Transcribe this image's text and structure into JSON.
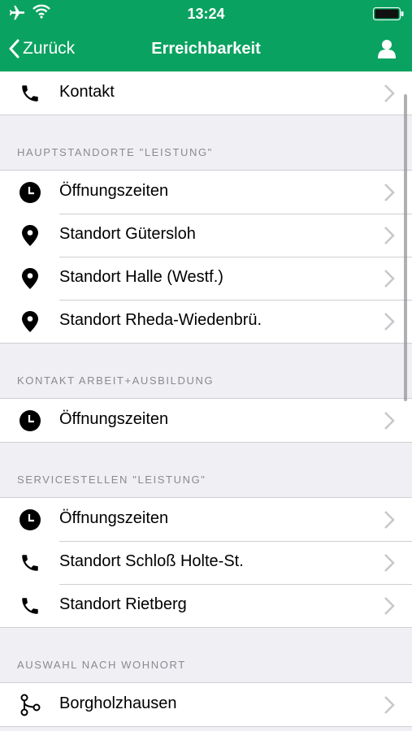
{
  "status_bar": {
    "time": "13:24"
  },
  "nav": {
    "back_label": "Zurück",
    "title": "Erreichbarkeit"
  },
  "top_item": {
    "label": "Kontakt",
    "icon": "phone-icon"
  },
  "sections": [
    {
      "header": "HAUPTSTANDORTE \"LEISTUNG\"",
      "items": [
        {
          "label": "Öffnungszeiten",
          "icon": "clock-icon"
        },
        {
          "label": "Standort Gütersloh",
          "icon": "location-pin-icon"
        },
        {
          "label": "Standort Halle (Westf.)",
          "icon": "location-pin-icon"
        },
        {
          "label": "Standort Rheda-Wiedenbrü.",
          "icon": "location-pin-icon"
        }
      ]
    },
    {
      "header": "KONTAKT ARBEIT+AUSBILDUNG",
      "items": [
        {
          "label": "Öffnungszeiten",
          "icon": "clock-icon"
        }
      ]
    },
    {
      "header": "SERVICESTELLEN \"LEISTUNG\"",
      "items": [
        {
          "label": "Öffnungszeiten",
          "icon": "clock-icon"
        },
        {
          "label": "Standort Schloß Holte-St.",
          "icon": "phone-icon"
        },
        {
          "label": "Standort Rietberg",
          "icon": "phone-icon"
        }
      ]
    },
    {
      "header": "AUSWAHL NACH WOHNORT",
      "items": [
        {
          "label": "Borgholzhausen",
          "icon": "route-icon"
        }
      ]
    }
  ],
  "colors": {
    "accent": "#0aa260",
    "background": "#efeff4",
    "separator": "#cfcfd4",
    "section_text": "#8a8a8f"
  }
}
